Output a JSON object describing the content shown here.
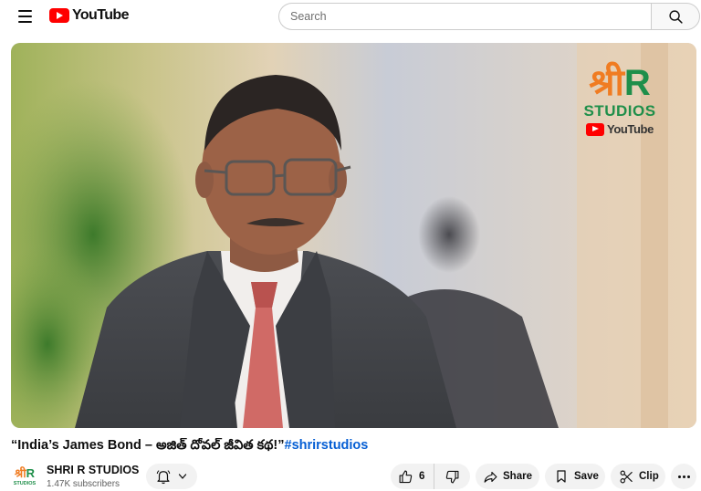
{
  "header": {
    "logo_text": "YouTube",
    "search_placeholder": "Search"
  },
  "video": {
    "watermark": {
      "shri": "श्री",
      "r": "R",
      "studios": "STUDIOS",
      "platform": "YouTube"
    }
  },
  "title": {
    "text": "“India’s James Bond – అజిత్ దోవల్ జీవిత కథ!”",
    "hashtag": "#shrirstudios"
  },
  "channel": {
    "avatar_text": "श्री",
    "avatar_r": "R",
    "avatar_sub": "STUDIOS",
    "name": "SHRI R STUDIOS",
    "subscribers": "1.47K subscribers"
  },
  "actions": {
    "like_count": "6",
    "share_label": "Share",
    "save_label": "Save",
    "clip_label": "Clip"
  },
  "colors": {
    "brand_red": "#ff0000",
    "watermark_orange": "#f07c22",
    "watermark_green": "#1f8f4a",
    "link_blue": "#065fd4"
  }
}
